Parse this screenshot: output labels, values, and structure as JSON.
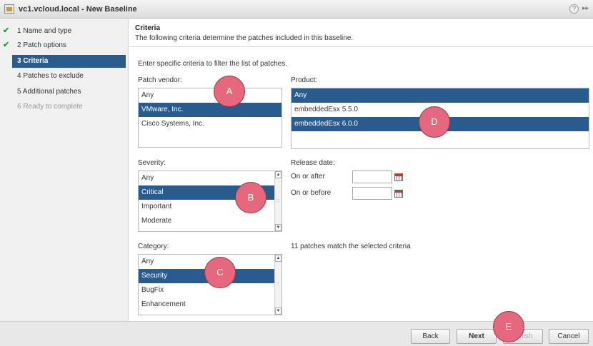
{
  "window": {
    "title": "vc1.vcloud.local - New Baseline",
    "help_icon": "?",
    "expand_icon": "▸▸"
  },
  "sidebar": {
    "steps": [
      {
        "label": "1  Name and type",
        "state": "done"
      },
      {
        "label": "2  Patch options",
        "state": "done"
      },
      {
        "label": "3  Criteria",
        "state": "active"
      },
      {
        "label": "4  Patches to exclude",
        "state": "pending"
      },
      {
        "label": "5  Additional patches",
        "state": "pending"
      },
      {
        "label": "6  Ready to complete",
        "state": "disabled"
      }
    ],
    "check_glyph": "✔"
  },
  "header": {
    "title": "Criteria",
    "subtitle": "The following criteria determine the patches included in this baseline."
  },
  "intro": "Enter specific criteria to filter the list of patches.",
  "patch_vendor": {
    "label": "Patch vendor:",
    "options": [
      "Any",
      "VMware, Inc.",
      "Cisco Systems, Inc."
    ],
    "selected": [
      "VMware, Inc."
    ]
  },
  "product": {
    "label": "Product:",
    "options": [
      "Any",
      "embeddedEsx 5.5.0",
      "embeddedEsx 6.0.0"
    ],
    "selected": [
      "Any",
      "embeddedEsx 6.0.0"
    ]
  },
  "severity": {
    "label": "Severity:",
    "options": [
      "Any",
      "Critical",
      "Important",
      "Moderate"
    ],
    "selected": [
      "Critical"
    ]
  },
  "release_date": {
    "label": "Release date:",
    "on_or_after_label": "On or after",
    "on_or_before_label": "On or before",
    "on_or_after_value": "",
    "on_or_before_value": ""
  },
  "category": {
    "label": "Category:",
    "options": [
      "Any",
      "Security",
      "BugFix",
      "Enhancement"
    ],
    "selected": [
      "Security"
    ]
  },
  "match_text": "11 patches match the selected criteria",
  "footer": {
    "back": "Back",
    "next": "Next",
    "finish": "Finish",
    "cancel": "Cancel"
  },
  "markers": [
    "A",
    "B",
    "C",
    "D",
    "E"
  ],
  "colors": {
    "selection": "#2a5b8e",
    "marker": "#e6687e",
    "check": "#2e9b3a"
  }
}
